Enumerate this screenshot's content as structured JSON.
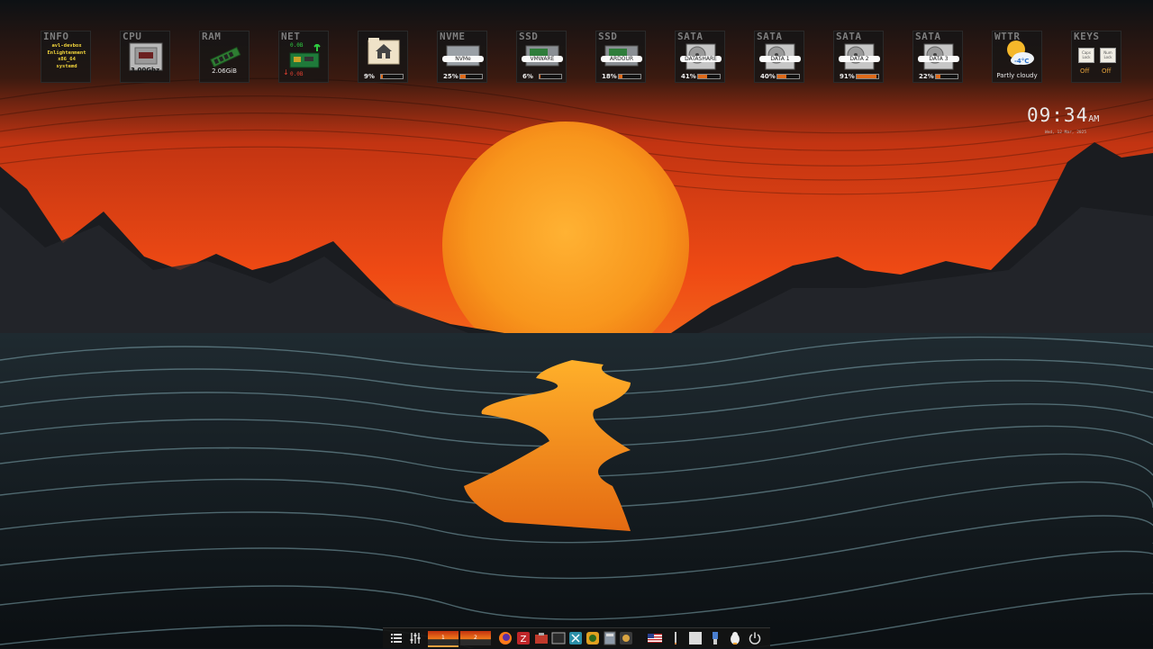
{
  "gadgets": {
    "info": {
      "title": "INFO",
      "lines": [
        "avl-devbox",
        "Enlightenment",
        "x86_64",
        "systemd"
      ]
    },
    "cpu": {
      "title": "CPU",
      "freq": "3.00Ghz"
    },
    "ram": {
      "title": "RAM",
      "used": "2.06GiB"
    },
    "net": {
      "title": "NET",
      "up": "0.0B",
      "down": "0.0B"
    },
    "home": {
      "title": "",
      "percent_text": "9%",
      "fill": 0.09
    },
    "nvme": {
      "title": "NVME",
      "label": "NVMe",
      "percent_text": "25%",
      "fill": 0.25
    },
    "ssd1": {
      "title": "SSD",
      "label": "VMWARE",
      "percent_text": "6%",
      "fill": 0.06
    },
    "ssd2": {
      "title": "SSD",
      "label": "ARDOUR",
      "percent_text": "18%",
      "fill": 0.18
    },
    "sata1": {
      "title": "SATA",
      "label": "DATASHARE",
      "percent_text": "41%",
      "fill": 0.41
    },
    "sata2": {
      "title": "SATA",
      "label": "DATA 1",
      "percent_text": "40%",
      "fill": 0.4
    },
    "sata3": {
      "title": "SATA",
      "label": "DATA 2",
      "percent_text": "91%",
      "fill": 0.91
    },
    "sata4": {
      "title": "SATA",
      "label": "DATA 3",
      "percent_text": "22%",
      "fill": 0.22
    },
    "wttr": {
      "title": "WTTR",
      "temp": "-4°C",
      "condition": "Partly cloudy"
    },
    "keys": {
      "title": "KEYS",
      "caps_label": "Caps Lock",
      "num_label": "Num Lock",
      "caps_state": "Off",
      "num_state": "Off"
    }
  },
  "clock": {
    "time": "09:34",
    "ampm": "AM",
    "date": "Wed, 12 Mar, 2025"
  },
  "pager": {
    "desks": [
      "1",
      "2"
    ]
  },
  "colors": {
    "bar_fill": "#e06a1a",
    "sun": "#f49a1c",
    "sky_top": "#0d1012",
    "sky_mid": "#e0401a"
  }
}
